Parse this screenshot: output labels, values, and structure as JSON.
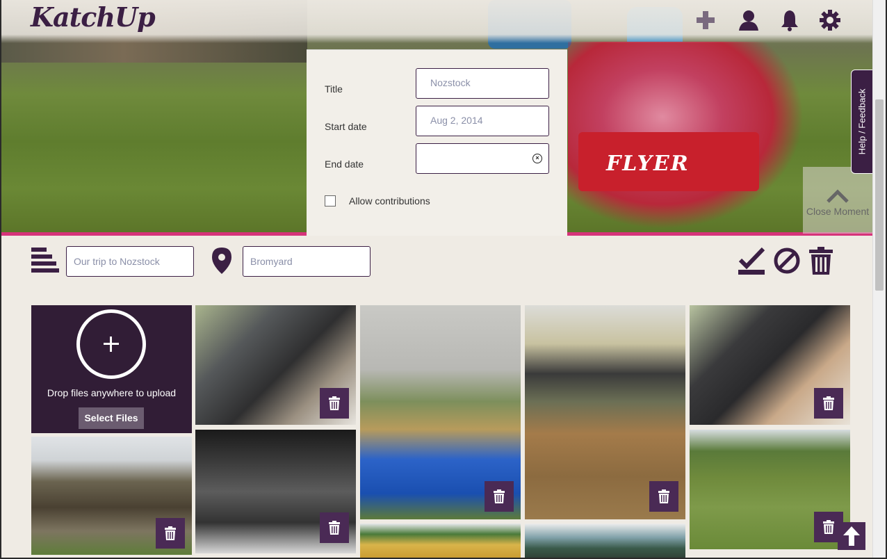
{
  "app": {
    "logo": "KatchUp"
  },
  "header": {
    "icons": [
      "plus-icon",
      "user-icon",
      "bell-icon",
      "gear-icon"
    ]
  },
  "moment_form": {
    "title_label": "Title",
    "title_placeholder": "Nozstock",
    "start_label": "Start date",
    "start_placeholder": "Aug 2, 2014",
    "end_label": "End date",
    "end_value": "",
    "allow_label": "Allow contributions",
    "allow_checked": false
  },
  "help_tab": "Help / Feedback",
  "close_moment": "Close Moment",
  "hero": {
    "sign_text": "FLYER"
  },
  "toolbar": {
    "description_placeholder": "Our trip to Nozstock",
    "location_placeholder": "Bromyard",
    "colors": {
      "accent": "#3b1f44",
      "pink": "#d6337a"
    }
  },
  "upload": {
    "drop_text": "Drop files anywhere to upload",
    "select_label": "Select Files"
  },
  "photos": [
    {
      "id": "car-kids"
    },
    {
      "id": "barrels"
    },
    {
      "id": "garden-stage"
    },
    {
      "id": "car-girl"
    },
    {
      "id": "hut"
    },
    {
      "id": "stage-performer"
    },
    {
      "id": "field-wagon"
    },
    {
      "id": "tent"
    },
    {
      "id": "dragon"
    }
  ]
}
